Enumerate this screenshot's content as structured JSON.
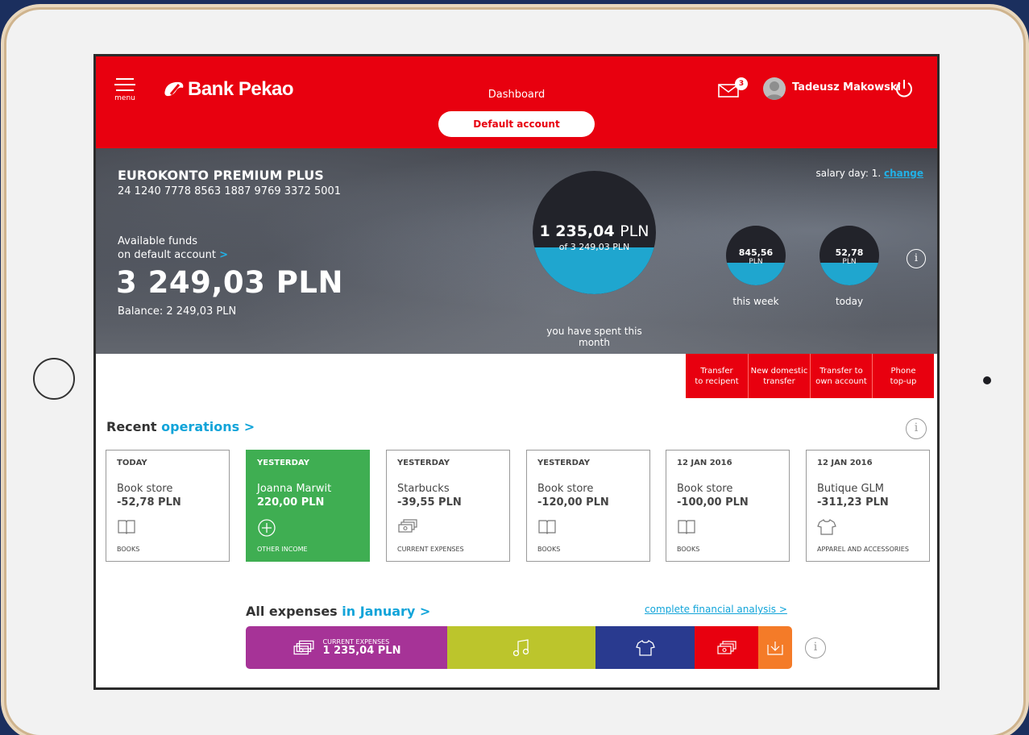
{
  "header": {
    "menu_label": "menu",
    "brand": "Bank Pekao",
    "page_title": "Dashboard",
    "account_selector": "Default account",
    "unread_messages": "3",
    "user_name": "Tadeusz Makowski"
  },
  "account": {
    "name": "EUROKONTO PREMIUM PLUS",
    "number": "24 1240 7778 8563 1887 9769 3372 5001",
    "salary_day_text": "salary day: 1.",
    "salary_change_link": "change",
    "funds_label_line1": "Available funds",
    "funds_label_line2": "on default account",
    "funds_arrow": ">",
    "available_funds": "3 249,03 PLN",
    "balance": "Balance: 2 249,03 PLN"
  },
  "spending": {
    "month_amount": "1 235,04",
    "month_currency": "PLN",
    "month_of": "of 3 249,03 PLN",
    "month_label": "you have spent this month",
    "week_amount": "845,56",
    "week_currency": "PLN",
    "week_label": "this week",
    "today_amount": "52,78",
    "today_currency": "PLN",
    "today_label": "today",
    "fill_ratio": 0.38
  },
  "quick_actions": [
    {
      "line1": "Transfer",
      "line2": "to recipent"
    },
    {
      "line1": "New domestic",
      "line2": "transfer"
    },
    {
      "line1": "Transfer to",
      "line2": "own account"
    },
    {
      "line1": "Phone",
      "line2": "top-up"
    }
  ],
  "recent": {
    "title_prefix": "Recent",
    "title_link": "operations >",
    "operations": [
      {
        "date": "TODAY",
        "merchant": "Book store",
        "amount": "-52,78 PLN",
        "category": "BOOKS",
        "icon": "book-icon"
      },
      {
        "date": "YESTERDAY",
        "merchant": "Joanna Marwit",
        "amount": "220,00 PLN",
        "category": "OTHER INCOME",
        "icon": "plus-circle-icon"
      },
      {
        "date": "YESTERDAY",
        "merchant": "Starbucks",
        "amount": "-39,55 PLN",
        "category": "CURRENT EXPENSES",
        "icon": "cash-icon"
      },
      {
        "date": "YESTERDAY",
        "merchant": "Book store",
        "amount": "-120,00 PLN",
        "category": "BOOKS",
        "icon": "book-icon"
      },
      {
        "date": "12 JAN 2016",
        "merchant": "Book store",
        "amount": "-100,00 PLN",
        "category": "BOOKS",
        "icon": "book-icon"
      },
      {
        "date": "12 JAN 2016",
        "merchant": "Butique GLM",
        "amount": "-311,23 PLN",
        "category": "APPAREL AND ACCESSORIES",
        "icon": "shirt-icon"
      }
    ]
  },
  "expenses": {
    "title_prefix": "All expenses",
    "title_link": "in January >",
    "analysis_link": "complete financial analysis >",
    "segments": [
      {
        "label": "CURRENT EXPENSES",
        "value": "1 235,04 PLN",
        "color": "#a63397",
        "icon": "cash-icon"
      },
      {
        "color": "#bcc52c",
        "icon": "music-icon"
      },
      {
        "color": "#293a8f",
        "icon": "shirt-icon"
      },
      {
        "color": "#e8000f",
        "icon": "cash-icon"
      },
      {
        "color": "#f47b28",
        "icon": "download-icon"
      }
    ]
  },
  "colors": {
    "brand_red": "#e8000f",
    "accent_blue": "#11a4d9",
    "income_green": "#3fae52"
  }
}
